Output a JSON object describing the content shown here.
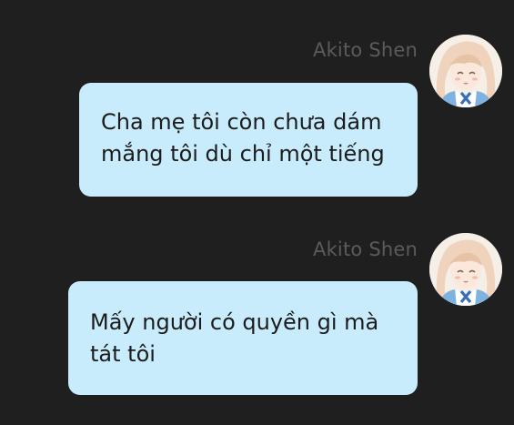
{
  "chat": {
    "messages": [
      {
        "sender": "Akito Shen",
        "lines": [
          "Cha mẹ tôi còn chưa dám",
          "mắng tôi dù chỉ một tiếng"
        ]
      },
      {
        "sender": "Akito Shen",
        "lines": [
          "Mấy người có quyền gì mà",
          "tát tôi"
        ]
      }
    ]
  },
  "colors": {
    "background": "#1f1f1f",
    "bubble": "#c9ecfd",
    "sender_name": "#5b5b5b",
    "text": "#1c1c1c"
  }
}
